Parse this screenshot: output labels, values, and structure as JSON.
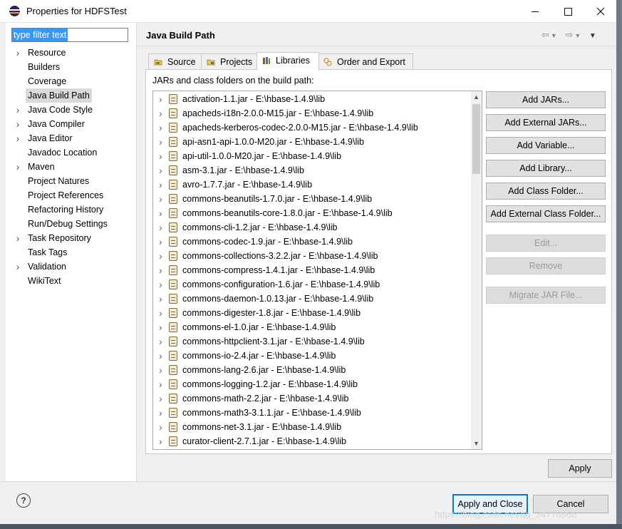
{
  "window": {
    "title": "Properties for HDFSTest",
    "minimize_label": "–",
    "maximize_label": "□",
    "close_label": "✕"
  },
  "filter": {
    "value": "type filter text"
  },
  "sidebar": {
    "items": [
      {
        "label": "Resource",
        "expandable": true
      },
      {
        "label": "Builders",
        "expandable": false
      },
      {
        "label": "Coverage",
        "expandable": false
      },
      {
        "label": "Java Build Path",
        "expandable": false,
        "selected": true
      },
      {
        "label": "Java Code Style",
        "expandable": true
      },
      {
        "label": "Java Compiler",
        "expandable": true
      },
      {
        "label": "Java Editor",
        "expandable": true
      },
      {
        "label": "Javadoc Location",
        "expandable": false
      },
      {
        "label": "Maven",
        "expandable": true
      },
      {
        "label": "Project Natures",
        "expandable": false
      },
      {
        "label": "Project References",
        "expandable": false
      },
      {
        "label": "Refactoring History",
        "expandable": false
      },
      {
        "label": "Run/Debug Settings",
        "expandable": false
      },
      {
        "label": "Task Repository",
        "expandable": true
      },
      {
        "label": "Task Tags",
        "expandable": false
      },
      {
        "label": "Validation",
        "expandable": true
      },
      {
        "label": "WikiText",
        "expandable": false
      }
    ]
  },
  "page": {
    "title": "Java Build Path",
    "tabs": [
      {
        "label": "Source",
        "icon": "source-folder-icon"
      },
      {
        "label": "Projects",
        "icon": "projects-icon"
      },
      {
        "label": "Libraries",
        "icon": "libraries-icon",
        "active": true
      },
      {
        "label": "Order and Export",
        "icon": "order-export-icon"
      }
    ],
    "caption": "JARs and class folders on the build path:",
    "jars": [
      "activation-1.1.jar - E:\\hbase-1.4.9\\lib",
      "apacheds-i18n-2.0.0-M15.jar - E:\\hbase-1.4.9\\lib",
      "apacheds-kerberos-codec-2.0.0-M15.jar - E:\\hbase-1.4.9\\lib",
      "api-asn1-api-1.0.0-M20.jar - E:\\hbase-1.4.9\\lib",
      "api-util-1.0.0-M20.jar - E:\\hbase-1.4.9\\lib",
      "asm-3.1.jar - E:\\hbase-1.4.9\\lib",
      "avro-1.7.7.jar - E:\\hbase-1.4.9\\lib",
      "commons-beanutils-1.7.0.jar - E:\\hbase-1.4.9\\lib",
      "commons-beanutils-core-1.8.0.jar - E:\\hbase-1.4.9\\lib",
      "commons-cli-1.2.jar - E:\\hbase-1.4.9\\lib",
      "commons-codec-1.9.jar - E:\\hbase-1.4.9\\lib",
      "commons-collections-3.2.2.jar - E:\\hbase-1.4.9\\lib",
      "commons-compress-1.4.1.jar - E:\\hbase-1.4.9\\lib",
      "commons-configuration-1.6.jar - E:\\hbase-1.4.9\\lib",
      "commons-daemon-1.0.13.jar - E:\\hbase-1.4.9\\lib",
      "commons-digester-1.8.jar - E:\\hbase-1.4.9\\lib",
      "commons-el-1.0.jar - E:\\hbase-1.4.9\\lib",
      "commons-httpclient-3.1.jar - E:\\hbase-1.4.9\\lib",
      "commons-io-2.4.jar - E:\\hbase-1.4.9\\lib",
      "commons-lang-2.6.jar - E:\\hbase-1.4.9\\lib",
      "commons-logging-1.2.jar - E:\\hbase-1.4.9\\lib",
      "commons-math-2.2.jar - E:\\hbase-1.4.9\\lib",
      "commons-math3-3.1.1.jar - E:\\hbase-1.4.9\\lib",
      "commons-net-3.1.jar - E:\\hbase-1.4.9\\lib",
      "curator-client-2.7.1.jar - E:\\hbase-1.4.9\\lib"
    ],
    "buttons": [
      {
        "label": "Add JARs...",
        "enabled": true
      },
      {
        "label": "Add External JARs...",
        "enabled": true
      },
      {
        "label": "Add Variable...",
        "enabled": true
      },
      {
        "label": "Add Library...",
        "enabled": true
      },
      {
        "label": "Add Class Folder...",
        "enabled": true
      },
      {
        "label": "Add External Class Folder...",
        "enabled": true
      },
      {
        "label": "Edit...",
        "enabled": false
      },
      {
        "label": "Remove",
        "enabled": false
      },
      {
        "label": "Migrate JAR File...",
        "enabled": false
      }
    ],
    "apply_label": "Apply"
  },
  "footer": {
    "help_label": "?",
    "apply_close_label": "Apply and Close",
    "cancel_label": "Cancel",
    "watermark": "https://blog.csdn.net/qq_34776966"
  },
  "colors": {
    "selection": "#3399ff",
    "default_button_border": "#0078d7"
  }
}
